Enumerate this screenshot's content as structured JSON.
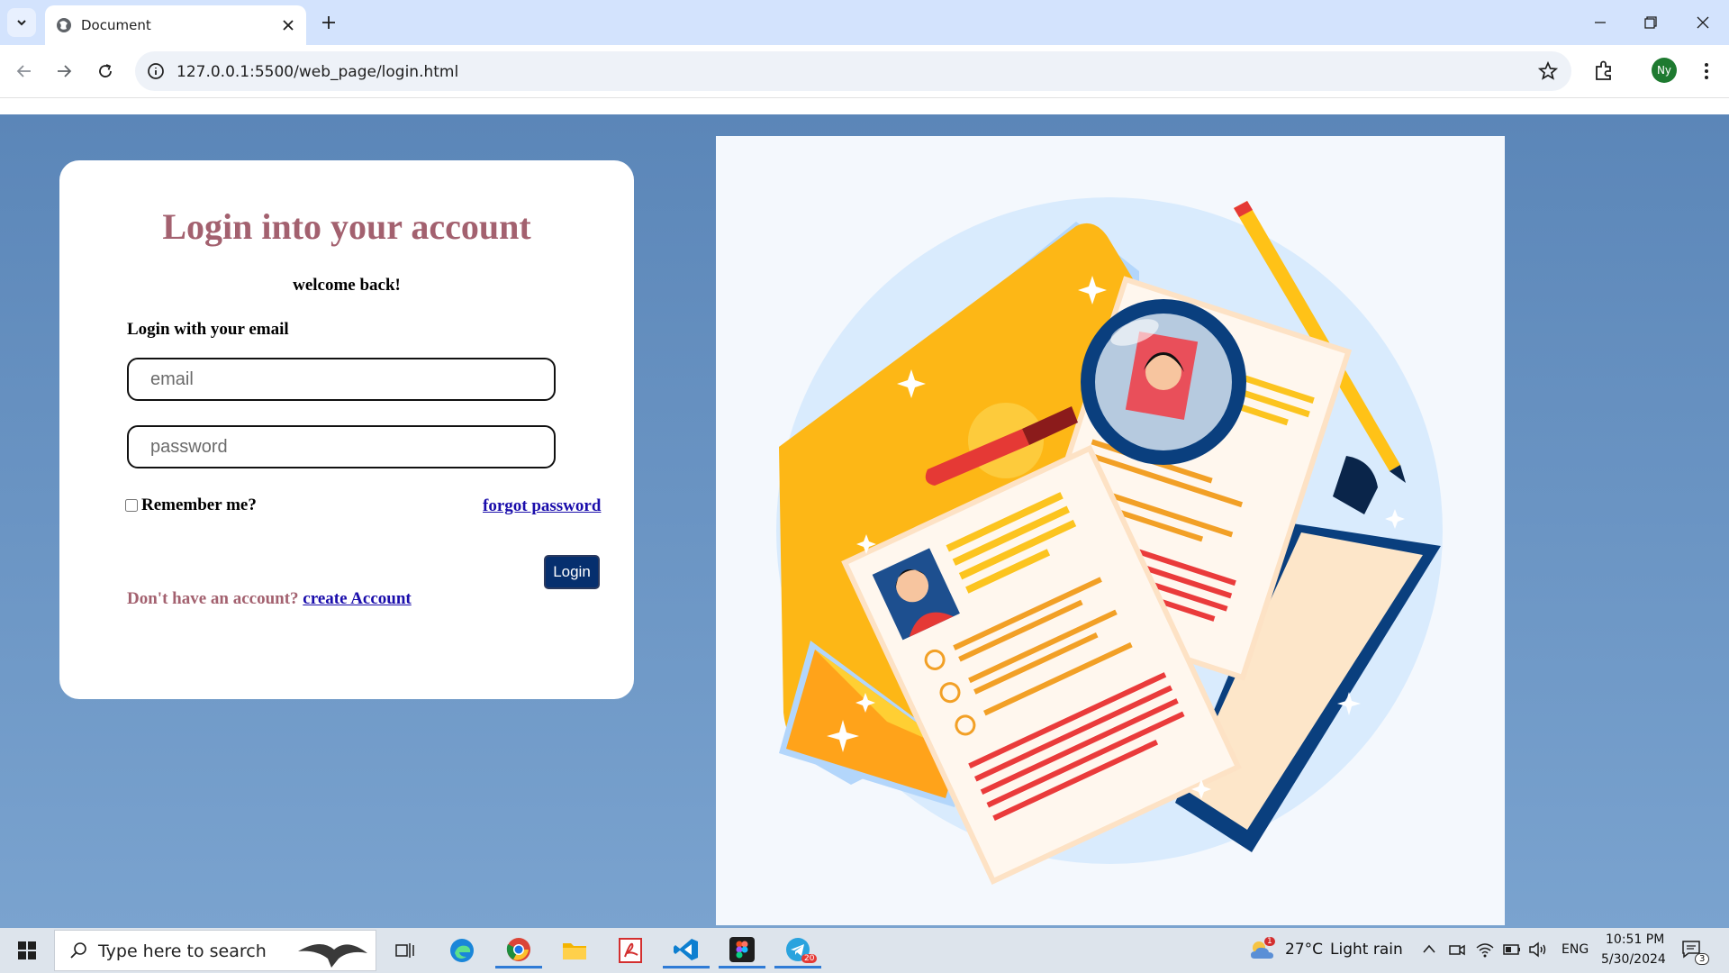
{
  "browser": {
    "tab_title": "Document",
    "url": "127.0.0.1:5500/web_page/login.html",
    "profile_initials": "Ny"
  },
  "login": {
    "title": "Login into your account",
    "welcome": "welcome back!",
    "login_with_label": "Login with your email",
    "email_placeholder": "email",
    "password_placeholder": "password",
    "remember_label": "Remember me?",
    "forgot_label": "forgot password",
    "login_button": "Login",
    "no_account_text": "Don't have an account?",
    "create_account_label": "create Account"
  },
  "taskbar": {
    "search_placeholder": "Type here to search",
    "weather_temp": "27°C",
    "weather_desc": "Light rain",
    "weather_alert_count": "1",
    "language": "ENG",
    "time": "10:51 PM",
    "date": "5/30/2024",
    "notification_count": "3",
    "telegram_badge": "20"
  },
  "colors": {
    "page_bg": "#6d93c3",
    "title_color": "#a3616f",
    "button_bg": "#062f6e",
    "link_color": "#1a0dab"
  }
}
